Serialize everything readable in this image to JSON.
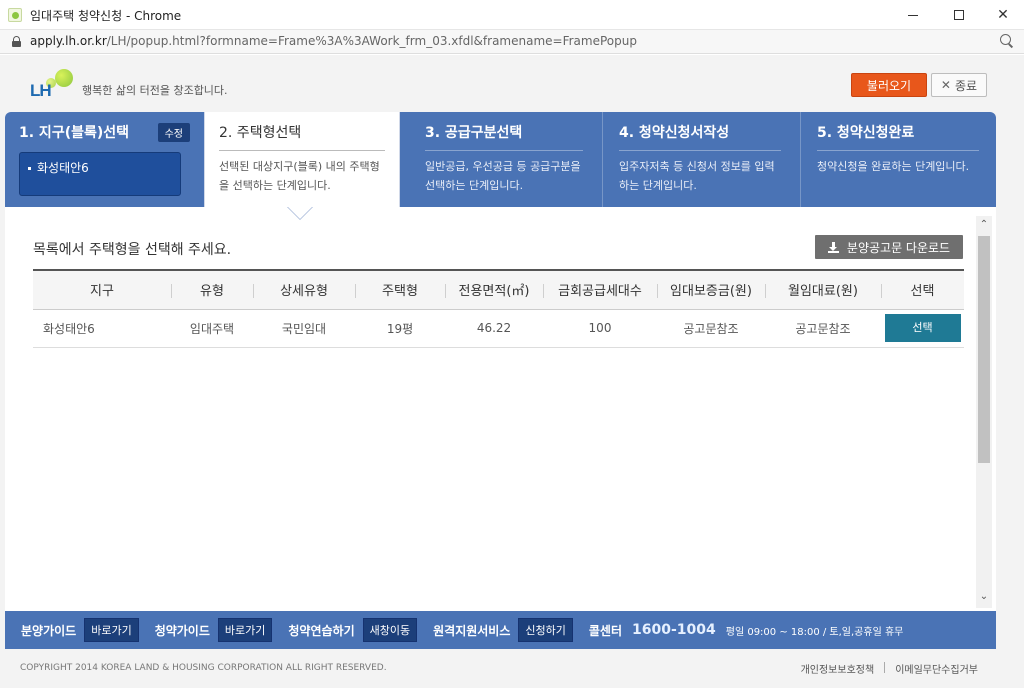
{
  "window": {
    "title": "임대주택 청약신청 - Chrome",
    "url_host": "apply.lh.or.kr",
    "url_path": "/LH/popup.html?formname=Frame%3A%3AWork_frm_03.xfdl&framename=FramePopup"
  },
  "header": {
    "logo_text": "LH",
    "slogan": "행복한 삶의 터전을 창조합니다.",
    "load_button": "불러오기",
    "close_button": "종료"
  },
  "steps": {
    "step1": {
      "name": "1. 지구(블록)선택",
      "edit": "수정",
      "region": "화성태안6"
    },
    "step2": {
      "name": "2. 주택형선택",
      "desc": "선택된 대상지구(블록) 내의 주택형을 선택하는 단계입니다."
    },
    "step3": {
      "name": "3. 공급구분선택",
      "desc": "일반공급, 우선공급 등 공급구분을 선택하는 단계입니다."
    },
    "step4": {
      "name": "4. 청약신청서작성",
      "desc": "입주자저축 등 신청서 정보를 입력하는 단계입니다."
    },
    "step5": {
      "name": "5. 청약신청완료",
      "desc": "청약신청을 완료하는 단계입니다."
    }
  },
  "main": {
    "instruction": "목록에서 주택형을 선택해 주세요.",
    "download_button": "분양공고문 다운로드",
    "columns": [
      "지구",
      "유형",
      "상세유형",
      "주택형",
      "전용면적(㎡)",
      "금회공급세대수",
      "임대보증금(원)",
      "월임대료(원)",
      "선택"
    ],
    "rows": [
      {
        "region": "화성태안6",
        "type": "임대주택",
        "detail_type": "국민임대",
        "housing_type": "19평",
        "area": "46.22",
        "units": "100",
        "deposit": "공고문참조",
        "rent": "공고문참조",
        "select": "선택"
      }
    ]
  },
  "bottombar": {
    "guide1_label": "분양가이드",
    "guide1_btn": "바로가기",
    "guide2_label": "청약가이드",
    "guide2_btn": "바로가기",
    "practice_label": "청약연습하기",
    "practice_btn": "새창이동",
    "remote_label": "원격지원서비스",
    "remote_btn": "신청하기",
    "callcenter_label": "콜센터",
    "callcenter_num": "1600-1004",
    "hours": "평일 09:00 ~ 18:00 / 토,일,공휴일 휴무"
  },
  "footer": {
    "copyright": "COPYRIGHT 2014 KOREA LAND & HOUSING CORPORATION ALL RIGHT RESERVED.",
    "privacy": "개인정보보호정책",
    "email": "이메일무단수집거부"
  }
}
